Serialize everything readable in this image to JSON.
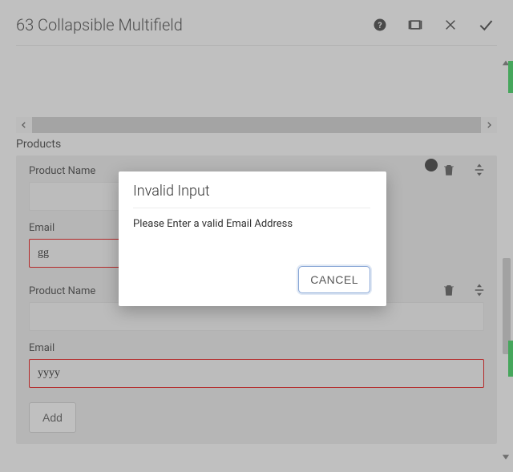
{
  "header": {
    "title": "63 Collapsible Multifield"
  },
  "section": {
    "label": "Products"
  },
  "items": [
    {
      "productName_label": "Product Name",
      "productName_value": "",
      "email_label": "Email",
      "email_value": "gg",
      "email_error": true
    },
    {
      "productName_label": "Product Name",
      "productName_value": "",
      "email_label": "Email",
      "email_value": "yyyy",
      "email_error": true
    }
  ],
  "add_label": "Add",
  "dialog": {
    "title": "Invalid Input",
    "message": "Please Enter a valid Email Address",
    "cancel_label": "CANCEL"
  }
}
